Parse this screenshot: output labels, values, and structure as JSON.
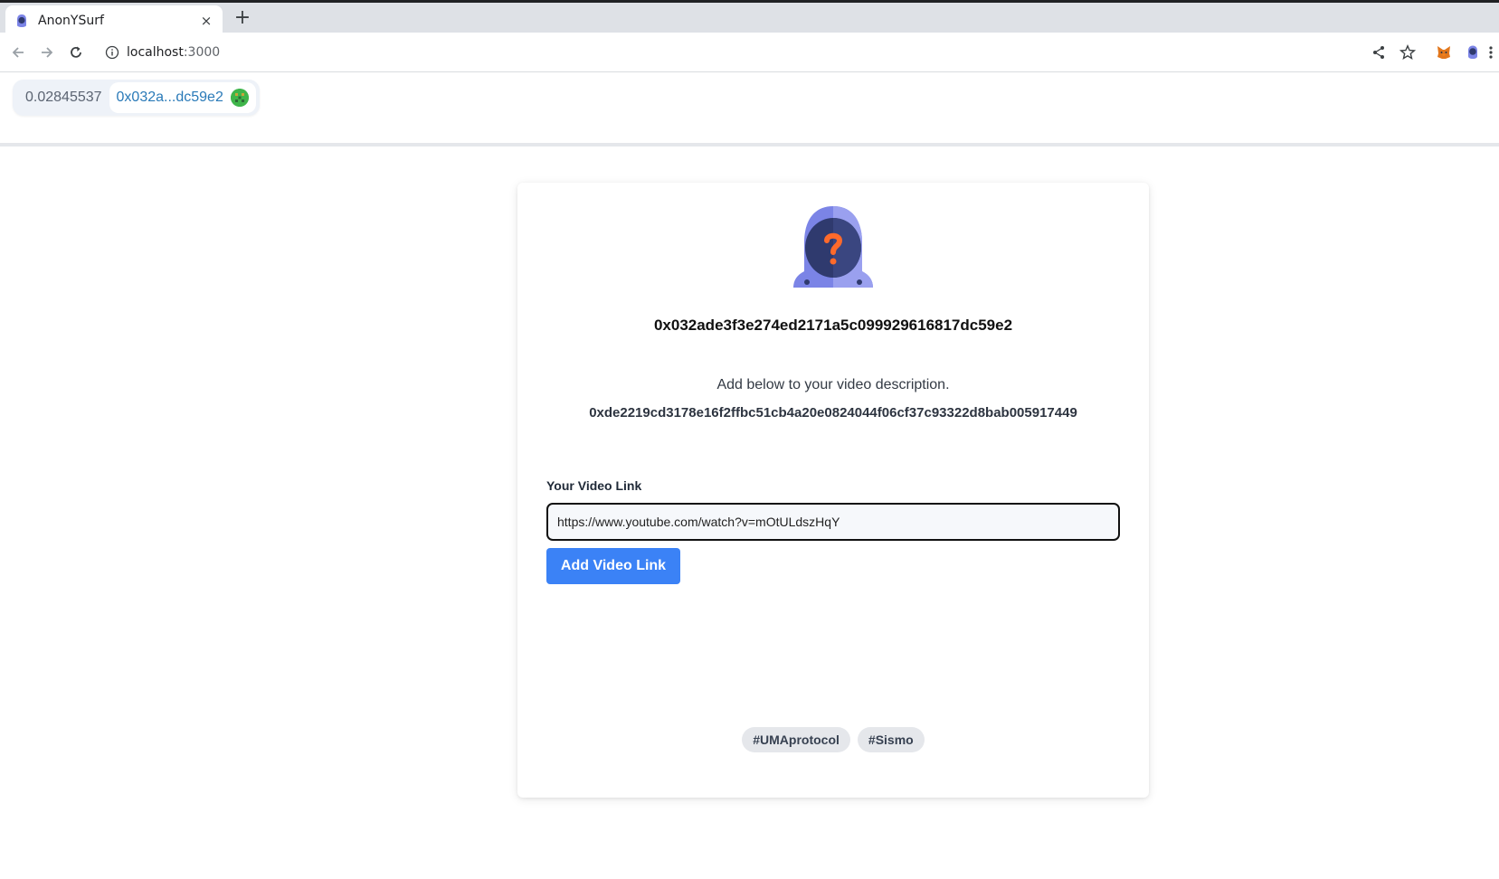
{
  "browser": {
    "tab_title": "AnonYSurf",
    "tab_close": "×",
    "new_tab": "+",
    "url_host": "localhost",
    "url_port": ":3000"
  },
  "wallet": {
    "balance": "0.02845537",
    "address_short": "0x032a...dc59e2"
  },
  "card": {
    "owner_address": "0x032ade3f3e274ed2171a5c099929616817dc59e2",
    "instruction": "Add below to your video description.",
    "description_hash": "0xde2219cd3178e16f2ffbc51cb4a20e0824044f06cf37c93322d8bab005917449",
    "video_link_label": "Your Video Link",
    "video_link_value": "https://www.youtube.com/watch?v=mOtULdszHqY",
    "add_button_label": "Add Video Link",
    "tags": [
      "#UMAprotocol",
      "#Sismo"
    ]
  },
  "colors": {
    "accent": "#3b82f6",
    "address_link": "#2a7ab8",
    "logo_hood": "#7b84e6",
    "logo_face": "#2f3a6e",
    "logo_question": "#ff6a2b"
  },
  "icons": [
    "back-arrow-icon",
    "forward-arrow-icon",
    "reload-icon",
    "info-icon",
    "share-icon",
    "star-icon",
    "metamask-icon",
    "extension-icon",
    "menu-icon"
  ]
}
